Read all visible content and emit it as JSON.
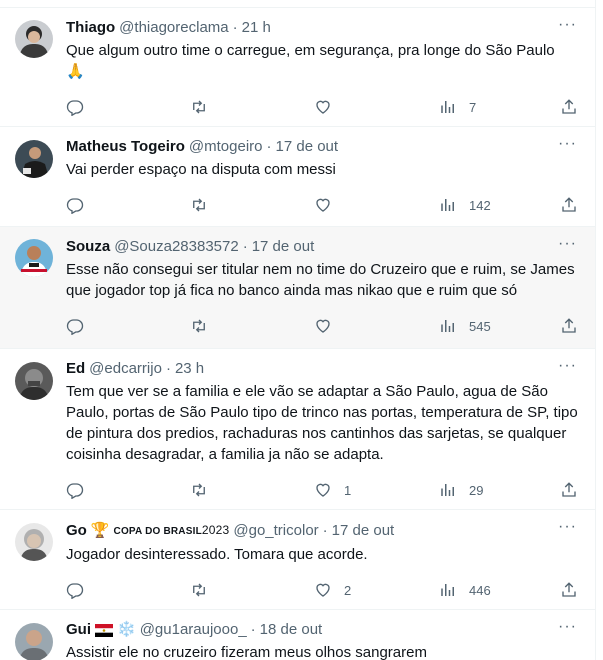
{
  "tweets": [
    {
      "name": "Thiago",
      "handle": "@thiagoreclama",
      "sep": "·",
      "time": "21 h",
      "text": "Que algum outro time o carregue, em segurança, pra longe do São Paulo",
      "emoji": "🙏",
      "likes": "",
      "views": "7"
    },
    {
      "name": "Matheus Togeiro",
      "handle": "@mtogeiro",
      "sep": "·",
      "time": "17 de out",
      "text": "Vai perder espaço na disputa com messi",
      "likes": "",
      "views": "142"
    },
    {
      "name": "Souza",
      "handle": "@Souza28383572",
      "sep": "·",
      "time": "17 de out",
      "text": "Esse não consegui ser titular nem no time do Cruzeiro que e ruim, se James que jogador top já fica no banco ainda mas nikao que e  ruim que só",
      "likes": "",
      "views": "545"
    },
    {
      "name": "Ed",
      "handle": "@edcarrijo",
      "sep": "·",
      "time": "23 h",
      "text": "Tem que ver se a familia e ele vão se adaptar a São Paulo, agua de São Paulo, portas de São Paulo tipo de trinco nas portas, temperatura de SP, tipo de pintura dos predios, rachaduras nos cantinhos das sarjetas, se qualquer coisinha desagradar, a familia ja não se adapta.",
      "likes": "1",
      "views": "29"
    },
    {
      "name": "Go",
      "name_badge": "🏆",
      "copa_text": "COPA DO BRASIL",
      "copa_year": "2023",
      "handle": "@go_tricolor",
      "sep": "·",
      "time": "17 de out",
      "text": "Jogador desinteressado. Tomara que acorde.",
      "likes": "2",
      "views": "446"
    },
    {
      "name": "Gui",
      "name_badge": "❄️",
      "handle": "@gu1araujooo_",
      "sep": "·",
      "time": "18 de out",
      "text": "Assistir ele no cruzeiro fizeram meus olhos sangrarem"
    }
  ],
  "more_icon": "···",
  "colors": {
    "secondary_text": "#536471",
    "highlight_bg": "#f7f7f7",
    "divider": "#eff3f4"
  }
}
